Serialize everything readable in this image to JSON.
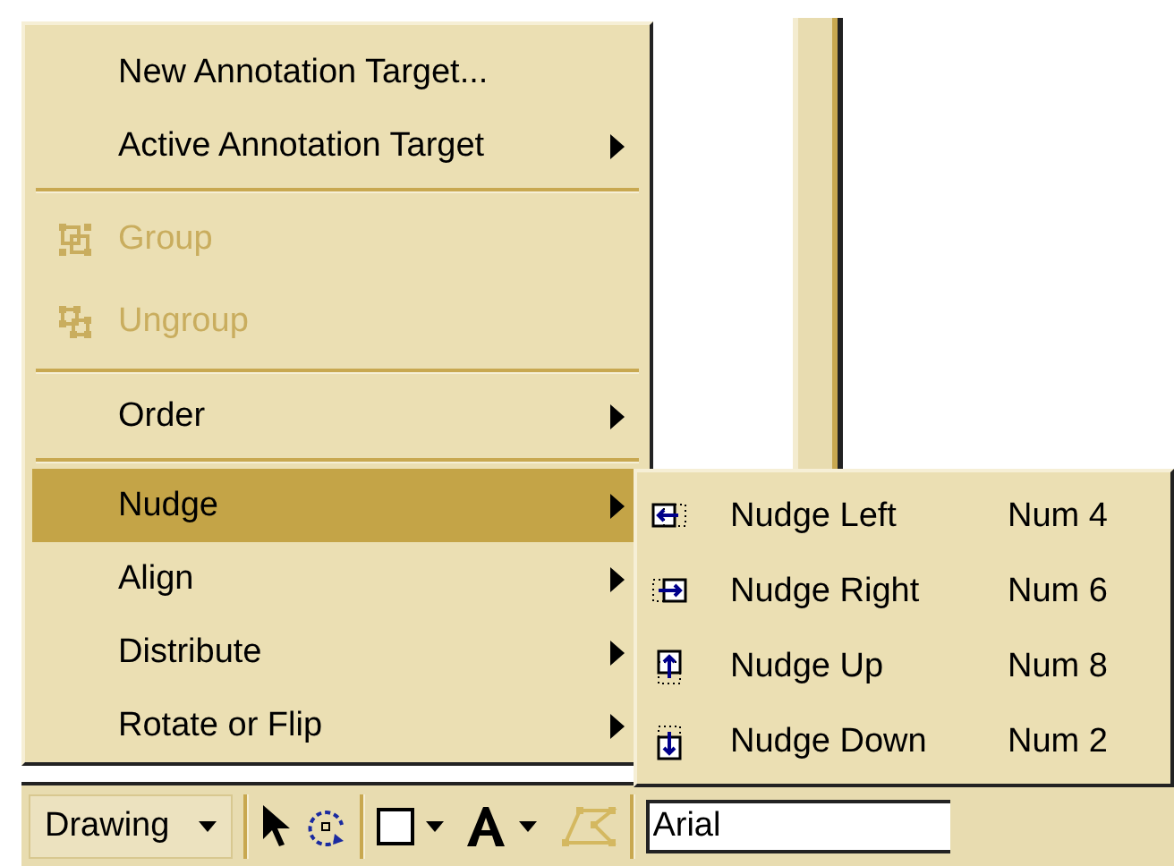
{
  "menu": [
    {
      "kind": "command",
      "label": "New Annotation Target...",
      "disabled": false,
      "selected": false,
      "submenu": false
    },
    {
      "kind": "command",
      "label": "Active Annotation Target",
      "disabled": false,
      "selected": false,
      "submenu": true
    },
    {
      "kind": "separator"
    },
    {
      "kind": "command",
      "label": "Group",
      "disabled": true,
      "selected": false,
      "submenu": false
    },
    {
      "kind": "command",
      "label": "Ungroup",
      "disabled": true,
      "selected": false,
      "submenu": false
    },
    {
      "kind": "separator"
    },
    {
      "kind": "command",
      "label": "Order",
      "disabled": false,
      "selected": false,
      "submenu": true
    },
    {
      "kind": "separator"
    },
    {
      "kind": "command",
      "label": "Nudge",
      "disabled": false,
      "selected": true,
      "submenu": true
    },
    {
      "kind": "command",
      "label": "Align",
      "disabled": false,
      "selected": false,
      "submenu": true
    },
    {
      "kind": "command",
      "label": "Distribute",
      "disabled": false,
      "selected": false,
      "submenu": true
    },
    {
      "kind": "command",
      "label": "Rotate or Flip",
      "disabled": false,
      "selected": false,
      "submenu": true
    }
  ],
  "submenu": [
    {
      "label": "Nudge Left",
      "shortcut": "Num 4"
    },
    {
      "label": "Nudge Right",
      "shortcut": "Num 6"
    },
    {
      "label": "Nudge Up",
      "shortcut": "Num 8"
    },
    {
      "label": "Nudge Down",
      "shortcut": "Num 2"
    }
  ],
  "toolbar": {
    "drawing_label": "Drawing",
    "font": {
      "value": "Arial"
    }
  }
}
